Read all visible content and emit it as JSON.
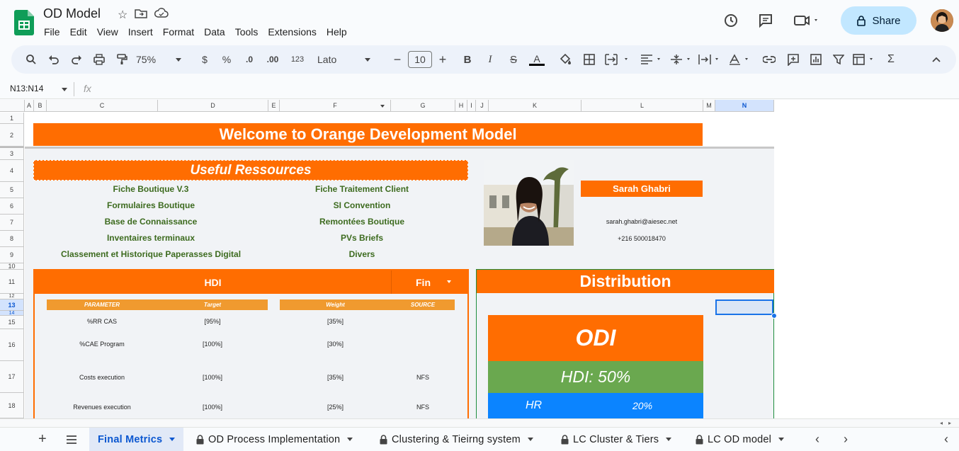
{
  "app": {
    "doc_title": "OD Model",
    "menus": [
      "File",
      "Edit",
      "View",
      "Insert",
      "Format",
      "Data",
      "Tools",
      "Extensions",
      "Help"
    ],
    "share_label": "Share",
    "brand_color": "#0f9d58"
  },
  "toolbar": {
    "zoom": "75%",
    "currency": "$",
    "percent": "%",
    "dec_less": ".0",
    "dec_more": ".00",
    "number_format": "123",
    "font": "Lato",
    "font_size": "10"
  },
  "formula": {
    "name_box": "N13:N14",
    "fx_label": "fx"
  },
  "columns": [
    "A",
    "B",
    "C",
    "D",
    "E",
    "F",
    "G",
    "H",
    "I",
    "J",
    "K",
    "L",
    "M",
    "N"
  ],
  "rows": [
    "1",
    "2",
    "3",
    "4",
    "5",
    "6",
    "7",
    "8",
    "9",
    "10",
    "11",
    "12",
    "13",
    "14",
    "15",
    "16",
    "17",
    "18"
  ],
  "sheet": {
    "welcome": "Welcome to Orange Development Model",
    "resources_title": "Useful Ressources",
    "resources_left": [
      "Fiche  Boutique V.3",
      "Formulaires Boutique",
      "Base de Connaissance",
      "Inventaires terminaux",
      "Classement et Historique Paperasses Digital"
    ],
    "resources_right": [
      "Fiche Traitement Client",
      "SI Convention",
      "Remontées Boutique",
      "PVs Briefs",
      "Divers"
    ],
    "contact_name": "Sarah Ghabri",
    "contact_email": "sarah.ghabri@aiesec.net",
    "contact_phone": "+216 500018470",
    "hdi_title": "HDI",
    "fin_label": "Fin",
    "table_headers": {
      "parameter": "PARAMETER",
      "target": "Target",
      "weight": "Weight",
      "source": "SOURCE"
    },
    "table_rows": [
      {
        "parameter": "%RR CAS",
        "target": "[95%]",
        "weight": "[35%]",
        "source": ""
      },
      {
        "parameter": "%CAE Program",
        "target": "[100%]",
        "weight": "[30%]",
        "source": ""
      },
      {
        "parameter": "Costs execution",
        "target": "[100%]",
        "weight": "[35%]",
        "source": "NFS"
      },
      {
        "parameter": "Revenues execution",
        "target": "[100%]",
        "weight": "[25%]",
        "source": "NFS"
      }
    ],
    "distribution_title": "Distribution",
    "odi": "ODI",
    "hdi_share": "HDI: 50%",
    "hr_label": "HR",
    "hr_share": "20%",
    "colors": {
      "orange": "#ff6d01",
      "green": "#6aa84f",
      "blue": "#0b84ff",
      "table_header": "#f09a2f",
      "link": "#3d6b1f"
    }
  },
  "tabs": [
    {
      "label": "Final Metrics",
      "active": true,
      "locked": false
    },
    {
      "label": "OD Process Implementation",
      "active": false,
      "locked": true
    },
    {
      "label": "Clustering & Tieirng system",
      "active": false,
      "locked": true
    },
    {
      "label": "LC Cluster & Tiers",
      "active": false,
      "locked": true
    },
    {
      "label": "LC OD model",
      "active": false,
      "locked": true
    }
  ]
}
